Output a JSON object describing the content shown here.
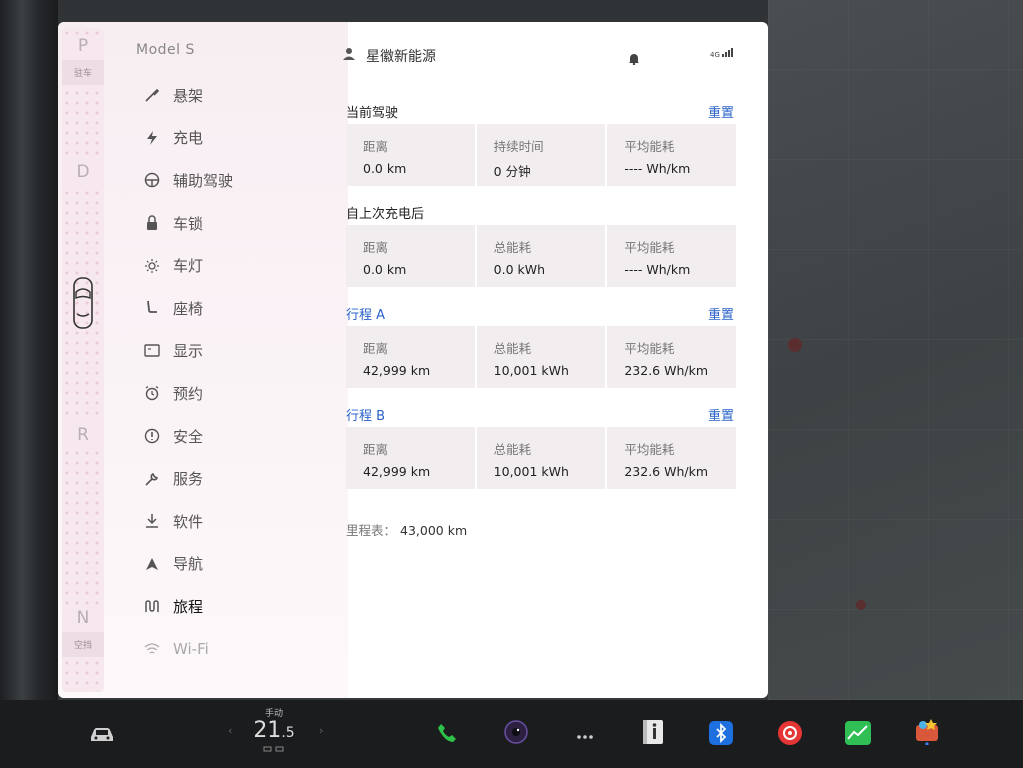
{
  "gear": {
    "p": "P",
    "p_sub": "驻车",
    "d": "D",
    "r": "R",
    "n": "N",
    "n_sub": "空挡"
  },
  "sidebar": {
    "brand": "Model S",
    "items": [
      {
        "label": "悬架",
        "icon": "wrench-pen-icon"
      },
      {
        "label": "充电",
        "icon": "bolt-icon"
      },
      {
        "label": "辅助驾驶",
        "icon": "steering-wheel-icon"
      },
      {
        "label": "车锁",
        "icon": "lock-icon"
      },
      {
        "label": "车灯",
        "icon": "sun-light-icon"
      },
      {
        "label": "座椅",
        "icon": "seat-icon"
      },
      {
        "label": "显示",
        "icon": "display-icon"
      },
      {
        "label": "预约",
        "icon": "alarm-clock-icon"
      },
      {
        "label": "安全",
        "icon": "info-circle-icon"
      },
      {
        "label": "服务",
        "icon": "wrench-icon"
      },
      {
        "label": "软件",
        "icon": "download-icon"
      },
      {
        "label": "导航",
        "icon": "navigation-arrow-icon"
      },
      {
        "label": "旅程",
        "icon": "trip-route-icon",
        "active": true
      },
      {
        "label": "Wi-Fi",
        "icon": "wifi-icon"
      }
    ]
  },
  "header": {
    "user_name": "星徽新能源",
    "signal_label": "4G"
  },
  "sections": {
    "current": {
      "title": "当前驾驶",
      "reset": "重置",
      "cards": [
        {
          "label": "距离",
          "value": "0.0  km"
        },
        {
          "label": "持续时间",
          "value": "0  分钟"
        },
        {
          "label": "平均能耗",
          "value": "----  Wh/km"
        }
      ]
    },
    "since_charge": {
      "title": "自上次充电后",
      "cards": [
        {
          "label": "距离",
          "value": "0.0  km"
        },
        {
          "label": "总能耗",
          "value": "0.0  kWh"
        },
        {
          "label": "平均能耗",
          "value": "----  Wh/km"
        }
      ]
    },
    "trip_a": {
      "title": "行程 A",
      "reset": "重置",
      "cards": [
        {
          "label": "距离",
          "value": "42,999  km"
        },
        {
          "label": "总能耗",
          "value": "10,001  kWh"
        },
        {
          "label": "平均能耗",
          "value": "232.6  Wh/km"
        }
      ]
    },
    "trip_b": {
      "title": "行程 B",
      "reset": "重置",
      "cards": [
        {
          "label": "距离",
          "value": "42,999  km"
        },
        {
          "label": "总能耗",
          "value": "10,001  kWh"
        },
        {
          "label": "平均能耗",
          "value": "232.6  Wh/km"
        }
      ]
    }
  },
  "odometer": {
    "label": "里程表：",
    "value": "43,000  km"
  },
  "dock": {
    "climate_mode": "手动",
    "temp_int": "21",
    "temp_dec": ".5"
  },
  "colors": {
    "accent_blue": "#2a62c9",
    "phone_green": "#2ec24a",
    "bluetooth_blue": "#1e6fe0",
    "music_red": "#e53535",
    "chart_green": "#2fbf55"
  }
}
